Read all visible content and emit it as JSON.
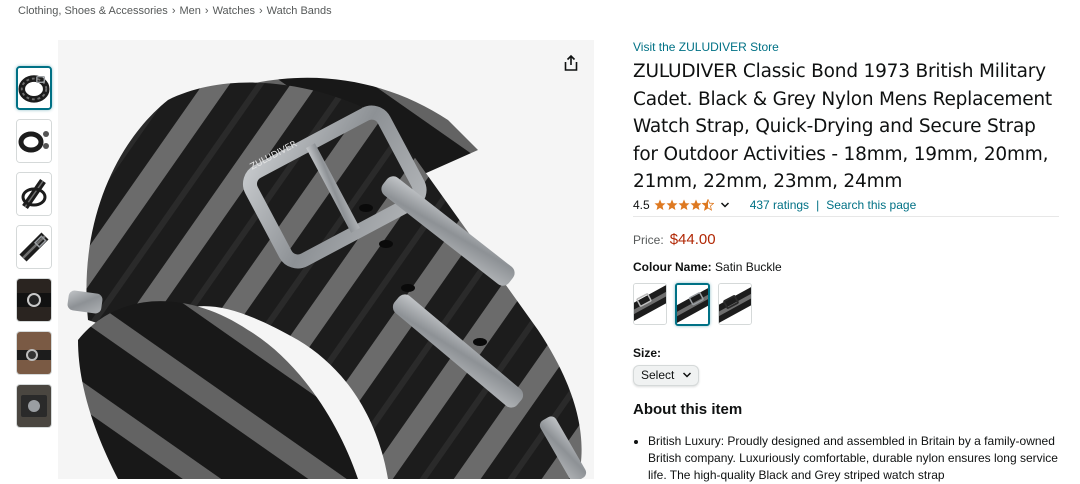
{
  "breadcrumb": {
    "items": [
      "Clothing, Shoes & Accessories",
      "Men",
      "Watches",
      "Watch Bands"
    ],
    "separator": "›"
  },
  "thumbnails": {
    "count": 7,
    "active_index": 0
  },
  "product": {
    "store_link": "Visit the ZULUDIVER Store",
    "title": "ZULUDIVER Classic Bond 1973 British Military Cadet. Black & Grey Nylon Mens Replacement Watch Strap, Quick-Drying and Secure Strap for Outdoor Activities - 18mm, 19mm, 20mm, 21mm, 22mm, 23mm, 24mm",
    "brand_on_buckle": "ZULUDIVER",
    "rating_value": "4.5",
    "rating_stars": 4.5,
    "ratings_count": "437 ratings",
    "search_page": "Search this page",
    "price_label": "Price:",
    "price": "$44.00",
    "colour_label": "Colour Name:",
    "colour_value": "Satin Buckle",
    "selected_swatch_index": 1,
    "size_label": "Size:",
    "size_select_value": "Select",
    "about_heading": "About this item",
    "about_bullets": [
      "British Luxury: Proudly designed and assembled in Britain by a family-owned British company. Luxuriously comfortable, durable nylon ensures long service life. The high-quality Black and Grey striped watch strap"
    ]
  },
  "icons": {
    "share": "share-icon",
    "star": "star-icon",
    "chevron": "chevron-down-icon"
  },
  "colors": {
    "link": "#007185",
    "price": "#b12704",
    "star": "#de7921",
    "text": "#0f1111",
    "muted": "#565959",
    "strap_black": "#1c1c1c",
    "strap_grey": "#6e6e6e",
    "buckle": "#9a9ea2"
  }
}
